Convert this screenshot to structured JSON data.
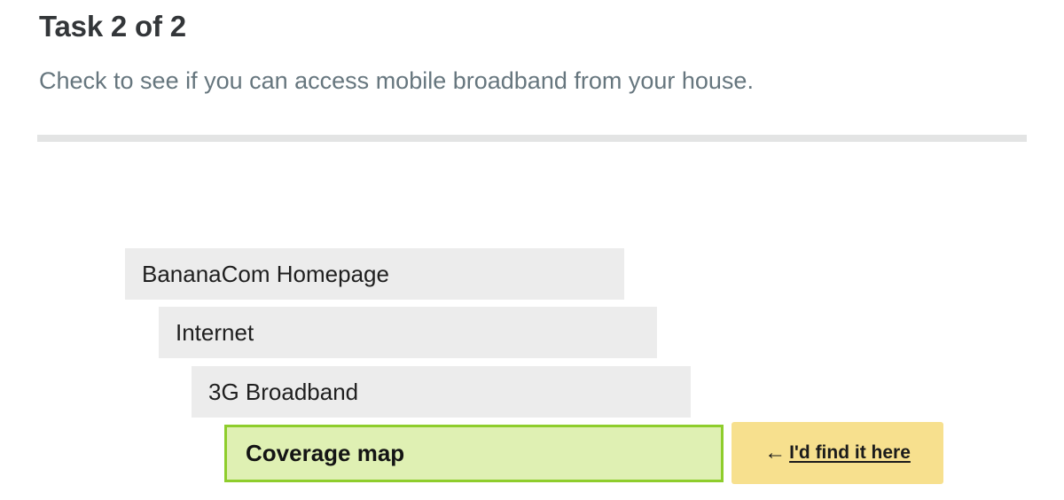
{
  "task": {
    "title": "Task 2 of 2",
    "instruction": "Check to see if you can access mobile broadband from your house."
  },
  "tree": {
    "nodes": [
      {
        "label": "BananaCom Homepage",
        "level": 1,
        "selected": false
      },
      {
        "label": "Internet",
        "level": 2,
        "selected": false
      },
      {
        "label": "3G Broadband",
        "level": 3,
        "selected": false
      },
      {
        "label": "Coverage map",
        "level": 4,
        "selected": true
      }
    ],
    "action": {
      "icon": "arrow-left-icon",
      "arrow": "←",
      "label": "I'd find it here"
    }
  },
  "colors": {
    "node_bg": "#ececec",
    "selected_bg": "#dff0b3",
    "selected_border": "#8ecd2c",
    "action_bg": "#f7e08e",
    "title": "#333639",
    "instruction": "#66767e"
  }
}
